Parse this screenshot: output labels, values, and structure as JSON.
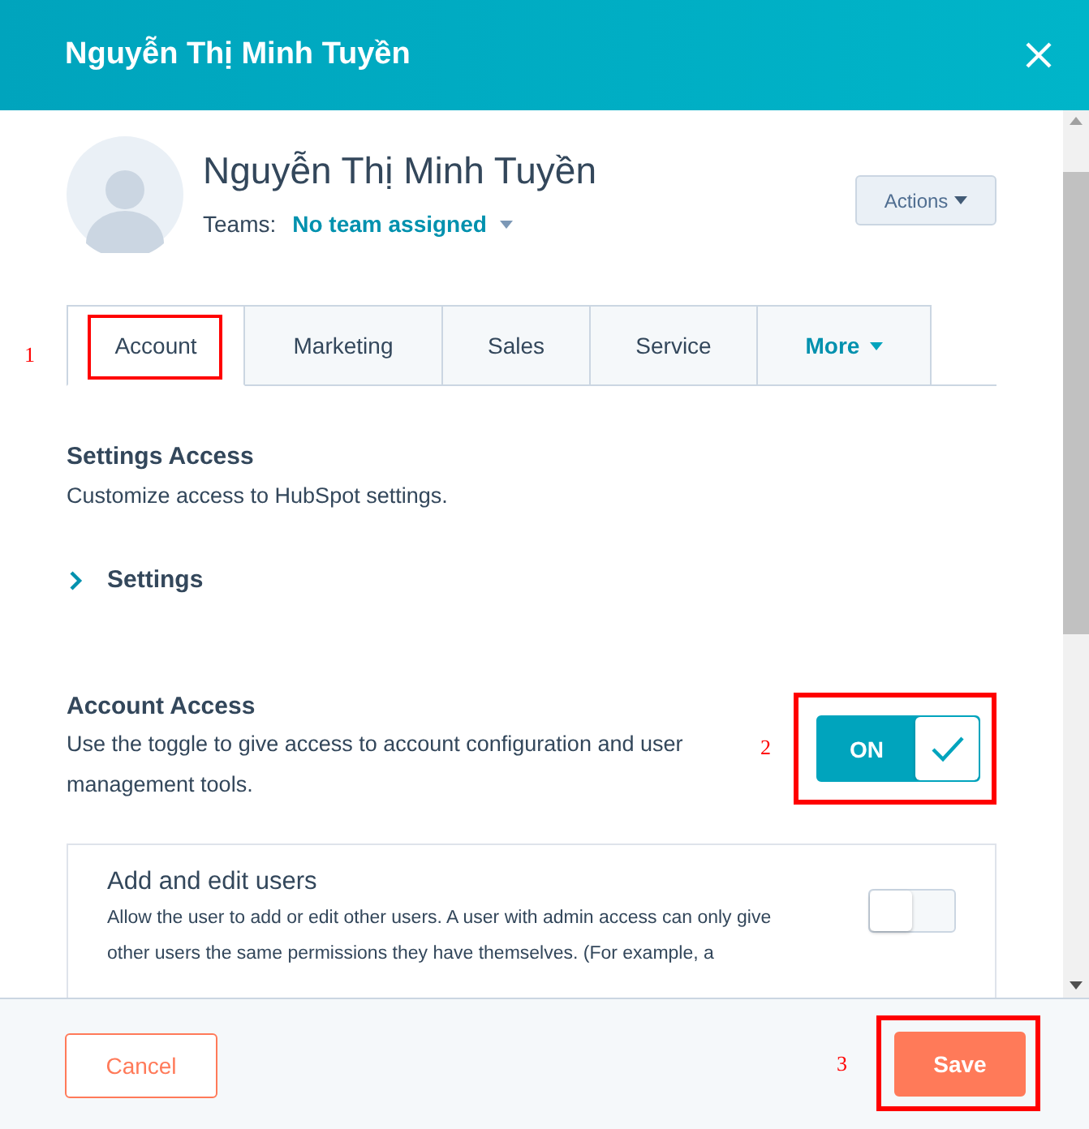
{
  "window": {
    "title": "Nguyễn Thị Minh Tuyền"
  },
  "profile": {
    "name": "Nguyễn Thị Minh Tuyền",
    "teams_label": "Teams:",
    "teams_value": "No team assigned",
    "actions": "Actions"
  },
  "tabs": [
    {
      "label": "Account",
      "selected": true,
      "callout": "1"
    },
    {
      "label": "Marketing",
      "selected": false
    },
    {
      "label": "Sales",
      "selected": false
    },
    {
      "label": "Service",
      "selected": false
    },
    {
      "label": "More",
      "selected": false,
      "kind": "dropdown"
    }
  ],
  "settings_access": {
    "title": "Settings Access",
    "description": "Customize access to HubSpot settings.",
    "section": {
      "label": "Settings",
      "expanded": false
    }
  },
  "account_access": {
    "title": "Account Access",
    "description": "Use the toggle to give access to account configuration and user management tools.",
    "toggle": {
      "label": "ON",
      "on": true,
      "callout": "2"
    }
  },
  "permissions": [
    {
      "title": "Add and edit users",
      "description": "Allow the user to add or edit other users. A user with admin access can only give other users the same permissions they have themselves. (For example, a",
      "on": false
    }
  ],
  "footer": {
    "cancel": "Cancel",
    "save": "Save",
    "save_callout": "3"
  }
}
